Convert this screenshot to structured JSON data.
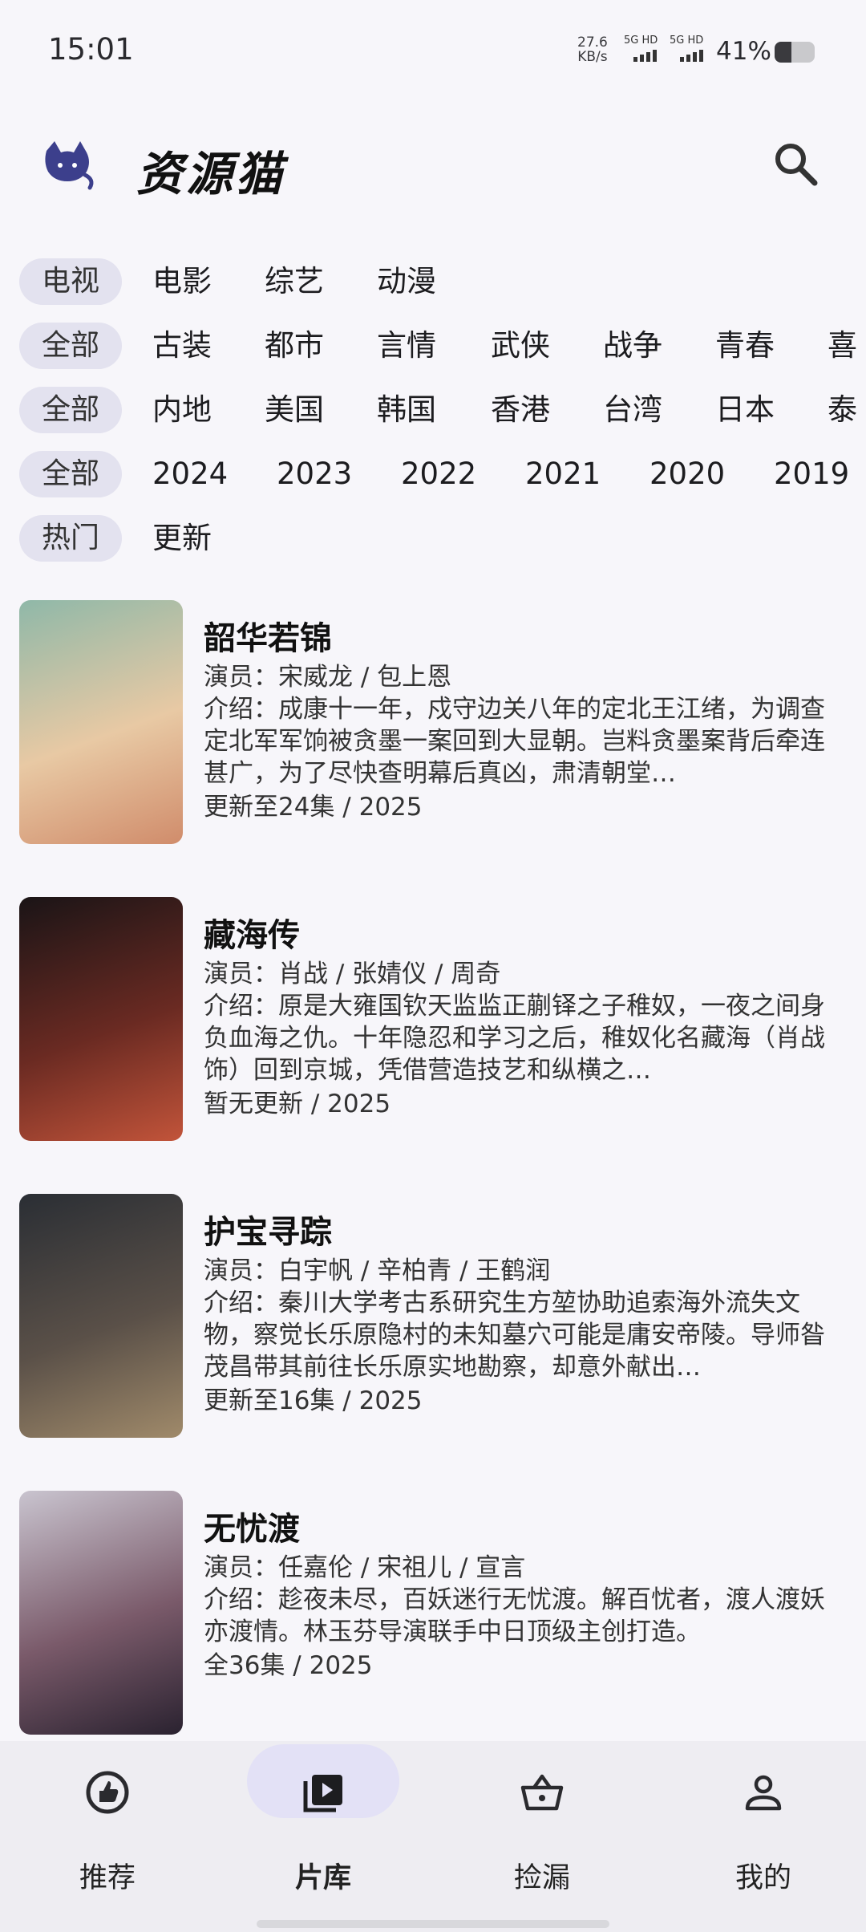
{
  "status": {
    "time": "15:01",
    "speed_value": "27.6",
    "speed_unit": "KB/s",
    "net1": "5G HD",
    "net2": "5G HD",
    "battery_pct": "41%",
    "battery_level": 0.41
  },
  "app": {
    "title": "资源猫"
  },
  "filters": [
    {
      "chip": "电视",
      "options": [
        "电影",
        "综艺",
        "动漫"
      ]
    },
    {
      "chip": "全部",
      "options": [
        "古装",
        "都市",
        "言情",
        "武侠",
        "战争",
        "青春",
        "喜"
      ]
    },
    {
      "chip": "全部",
      "options": [
        "内地",
        "美国",
        "韩国",
        "香港",
        "台湾",
        "日本",
        "泰"
      ]
    },
    {
      "chip": "全部",
      "options": [
        "2024",
        "2023",
        "2022",
        "2021",
        "2020",
        "2019"
      ]
    },
    {
      "chip": "热门",
      "options": [
        "更新"
      ]
    }
  ],
  "items": [
    {
      "title": "韶华若锦",
      "cast": "演员：宋威龙 / 包上恩",
      "desc": "介绍：成康十一年，戍守边关八年的定北王江绪，为调查定北军军饷被贪墨一案回到大显朝。岂料贪墨案背后牵连甚广，为了尽快查明幕后真凶，肃清朝堂…",
      "meta": "更新至24集 / 2025",
      "colors": [
        "#8fb8a8",
        "#e8c9a4",
        "#d08c6b"
      ]
    },
    {
      "title": "藏海传",
      "cast": "演员：肖战 / 张婧仪 / 周奇",
      "desc": "介绍：原是大雍国钦天监监正蒯铎之子稚奴，一夜之间身负血海之仇。十年隐忍和学习之后，稚奴化名藏海（肖战 饰）回到京城，凭借营造技艺和纵横之…",
      "meta": "暂无更新 / 2025",
      "colors": [
        "#1a1416",
        "#6a2a22",
        "#c2543a"
      ]
    },
    {
      "title": "护宝寻踪",
      "cast": "演员：白宇帆 / 辛柏青 / 王鹤润",
      "desc": "介绍：秦川大学考古系研究生方堃协助追索海外流失文物，察觉长乐原隐村的未知墓穴可能是庸安帝陵。导师昝茂昌带其前往长乐原实地勘察，却意外献出…",
      "meta": "更新至16集 / 2025",
      "colors": [
        "#2a2e34",
        "#5a5048",
        "#a08a6a"
      ]
    },
    {
      "title": "无忧渡",
      "cast": "演员：任嘉伦 / 宋祖儿 / 宣言",
      "desc": "介绍：趁夜未尽，百妖迷行无忧渡。解百忧者，渡人渡妖亦渡情。林玉芬导演联手中日顶级主创打造。",
      "meta": "全36集 / 2025",
      "colors": [
        "#c9c4cf",
        "#7a5a6a",
        "#2a2230"
      ]
    }
  ],
  "nav": [
    {
      "label": "推荐",
      "icon": "thumb-up-icon",
      "active": false
    },
    {
      "label": "片库",
      "icon": "video-library-icon",
      "active": true
    },
    {
      "label": "捡漏",
      "icon": "basket-icon",
      "active": false
    },
    {
      "label": "我的",
      "icon": "person-icon",
      "active": false
    }
  ]
}
